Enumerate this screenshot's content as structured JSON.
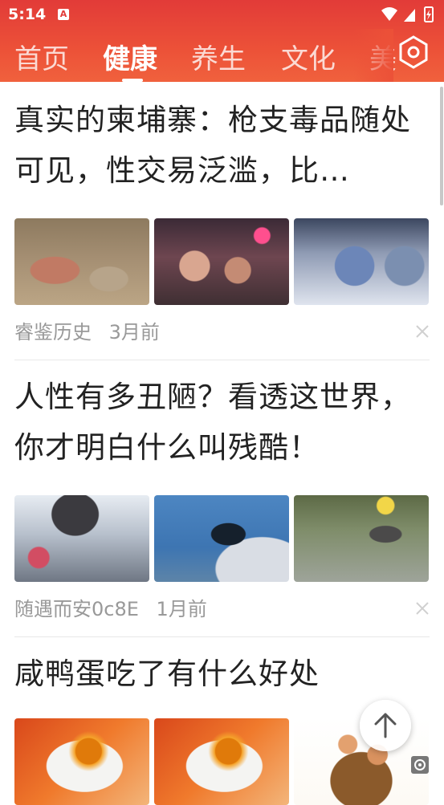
{
  "status": {
    "time": "5:14",
    "notif": "A"
  },
  "tabs": [
    {
      "label": "首页"
    },
    {
      "label": "健康",
      "active": true
    },
    {
      "label": "养生"
    },
    {
      "label": "文化"
    },
    {
      "label": "美"
    }
  ],
  "articles": [
    {
      "title": "真实的柬埔寨：枪支毒品随处可见，性交易泛滥，比…",
      "source": "睿鉴历史",
      "time": "3月前",
      "image_names": [
        "children-photo",
        "street-women-photo",
        "police-photo"
      ]
    },
    {
      "title": "人性有多丑陋？看透这世界，你才明白什么叫残酷！",
      "source": "随遇而安0c8E",
      "time": "1月前",
      "image_names": [
        "mountain-photo",
        "sitting-woman-photo",
        "path-worker-photo"
      ]
    },
    {
      "title": "咸鸭蛋吃了有什么好处",
      "image_names": [
        "salted-egg-photo",
        "salted-egg-photo-2",
        "egg-basket-photo"
      ]
    }
  ],
  "colors": {
    "header_top": "#e23b38",
    "header_bottom": "#f0613d",
    "meta_text": "#999999",
    "title_text": "#222222"
  }
}
